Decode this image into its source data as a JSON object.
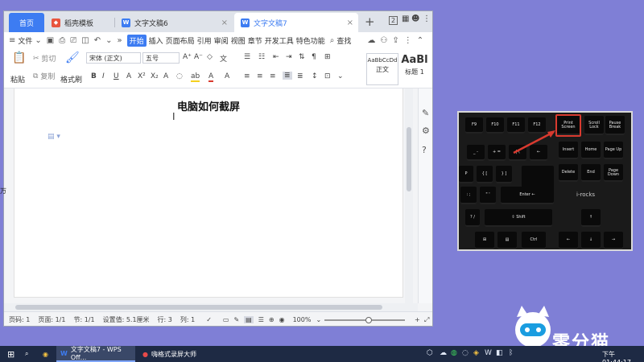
{
  "window": {
    "tabs": [
      {
        "label": "首页"
      },
      {
        "label": "稻壳模板"
      },
      {
        "label": "文字文稿6"
      },
      {
        "label": "文字文稿7"
      }
    ],
    "tab_badge": "2"
  },
  "toolbar": {
    "file_label": "文件",
    "menus": [
      "开始",
      "插入",
      "页面布局",
      "引用",
      "审阅",
      "视图",
      "章节",
      "开发工具",
      "特色功能"
    ],
    "search_label": "查找"
  },
  "ribbon": {
    "paste": "粘贴",
    "cut": "剪切",
    "copy": "复制",
    "format_painter": "格式刷",
    "font_name": "宋体 (正文)",
    "font_size": "五号",
    "styles": [
      {
        "preview": "AaBbCcDd",
        "label": "正文"
      },
      {
        "preview": "AaBl",
        "label": "标题 1"
      }
    ]
  },
  "document": {
    "title": "电脑如何截屏"
  },
  "statusbar": {
    "page_num": "页码: 1",
    "pages": "页面: 1/1",
    "section": "节: 1/1",
    "setting": "设置值: 5.1厘米",
    "row": "行: 3",
    "col": "列: 1",
    "zoom": "100%",
    "zoom_fraction": 0.55
  },
  "keyboard_photo": {
    "keys": {
      "f9": "F9",
      "f10": "F10",
      "f11": "F11",
      "f12": "F12",
      "print_screen": "Print Screen",
      "scroll_lock": "Scroll Lock",
      "pause_break": "Pause Break",
      "insert": "Insert",
      "home": "Home",
      "page_up": "Page Up",
      "delete": "Delete",
      "end": "End",
      "page_down": "Page Down",
      "enter": "Enter ←",
      "shift": "Shift",
      "ctrl": "Ctrl"
    },
    "brand": "i-rocks"
  },
  "watermark": {
    "text": "零分猫"
  },
  "taskbar": {
    "wps_task": "文字文稿7 - WPS Off...",
    "recorder_task": "嗨格式录屏大师",
    "clock": "下午 01:44:17"
  },
  "colors": {
    "accent": "#3d7cf2",
    "desktop": "#7f7fd6",
    "taskbar": "#1e2a44",
    "highlight": "#d83a2f"
  }
}
